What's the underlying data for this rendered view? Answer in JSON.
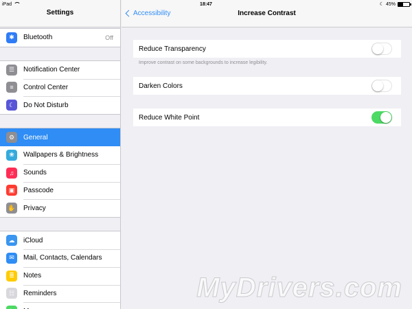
{
  "status_bar": {
    "device": "iPad",
    "time": "18:47",
    "battery_text": "45%",
    "battery_level": 0.45
  },
  "sidebar": {
    "title": "Settings",
    "groups": [
      {
        "items": [
          {
            "label": "Bluetooth",
            "value": "Off",
            "icon": "bluetooth-icon",
            "color": "#2f7cf6",
            "glyph": "✱"
          }
        ]
      },
      {
        "items": [
          {
            "label": "Notification Center",
            "icon": "notification-center-icon",
            "color": "#8e8e93",
            "glyph": "☰"
          },
          {
            "label": "Control Center",
            "icon": "control-center-icon",
            "color": "#8e8e93",
            "glyph": "≡"
          },
          {
            "label": "Do Not Disturb",
            "icon": "moon-icon",
            "color": "#5856d6",
            "glyph": "☾"
          }
        ]
      },
      {
        "items": [
          {
            "label": "General",
            "icon": "gear-icon",
            "color": "#8e8e93",
            "glyph": "⚙",
            "selected": true
          },
          {
            "label": "Wallpapers & Brightness",
            "icon": "wallpaper-icon",
            "color": "#34aadc",
            "glyph": "❀"
          },
          {
            "label": "Sounds",
            "icon": "speaker-icon",
            "color": "#ff2d55",
            "glyph": "♫"
          },
          {
            "label": "Passcode",
            "icon": "lock-icon",
            "color": "#ff3b30",
            "glyph": "▣"
          },
          {
            "label": "Privacy",
            "icon": "hand-icon",
            "color": "#8e8e93",
            "glyph": "✋"
          }
        ]
      },
      {
        "items": [
          {
            "label": "iCloud",
            "icon": "cloud-icon",
            "color": "#3a96f0",
            "glyph": "☁"
          },
          {
            "label": "Mail, Contacts, Calendars",
            "icon": "mail-icon",
            "color": "#2f8df5",
            "glyph": "✉"
          },
          {
            "label": "Notes",
            "icon": "notes-icon",
            "color": "#ffcc00",
            "glyph": "≣"
          },
          {
            "label": "Reminders",
            "icon": "reminders-icon",
            "color": "#d8d8dc",
            "glyph": "☷"
          },
          {
            "label": "Messages",
            "icon": "messages-icon",
            "color": "#4cd964",
            "glyph": "✎"
          }
        ]
      }
    ]
  },
  "main": {
    "back_label": "Accessibility",
    "title": "Increase Contrast",
    "rows": [
      {
        "label": "Reduce Transparency",
        "on": false,
        "footnote": "Improve contrast on some backgrounds to increase legibility."
      },
      {
        "label": "Darken Colors",
        "on": false
      },
      {
        "label": "Reduce White Point",
        "on": true
      }
    ]
  },
  "watermark": "MyDrivers.com",
  "colors": {
    "accent": "#2f8df5",
    "toggle_on": "#4cd964"
  }
}
